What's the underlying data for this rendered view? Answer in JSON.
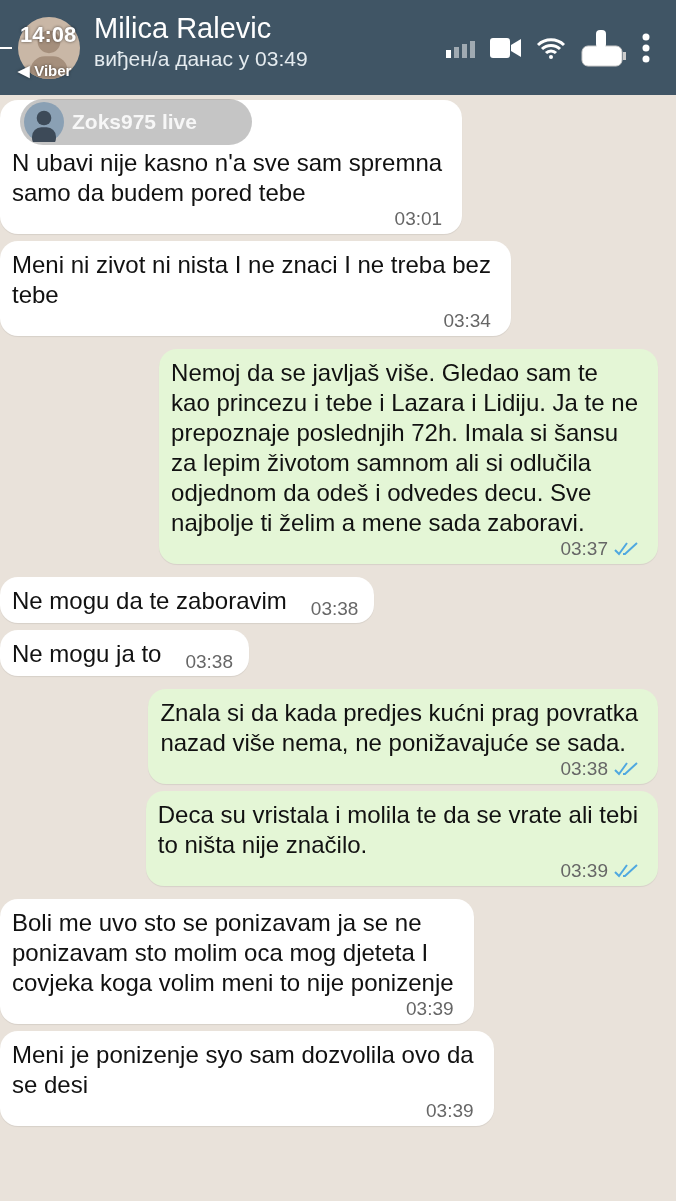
{
  "status_bar": {
    "time": "14:08",
    "back_app": "◀ Viber"
  },
  "header": {
    "name": "Milica Ralevic",
    "last_seen": "виђен/а данас у 03:49"
  },
  "live_overlay": {
    "label": "Zoks975 live"
  },
  "messages": [
    {
      "kind": "received",
      "text": "N     ubavi nije kasno n'a sve sam spremna\nsamo da budem pored tebe",
      "time": "03:01",
      "inline": false
    },
    {
      "kind": "received",
      "text": "Meni ni zivot ni nista I ne znaci I ne treba bez\ntebe",
      "time": "03:34",
      "inline": false
    },
    {
      "kind": "sent",
      "text": "Nemoj da se javljaš više. Gledao sam te\nkao princezu i tebe i Lazara i Lidiju. Ja te ne\nprepoznaje poslednjih 72h. Imala si šansu\nza lepim životom samnom ali si odlučila\nodjednom da odeš i odvedes decu. Sve\nnajbolje ti želim a mene sada zaboravi.",
      "time": "03:37",
      "read": true,
      "inline": false
    },
    {
      "kind": "received",
      "text": "Ne mogu da te zaboravim",
      "time": "03:38",
      "inline": true
    },
    {
      "kind": "received",
      "text": "Ne mogu ja to",
      "time": "03:38",
      "inline": true
    },
    {
      "kind": "sent",
      "text": "Znala si da kada predjes kućni prag povratka\nnazad više nema, ne ponižavajuće se sada.",
      "time": "03:38",
      "read": true,
      "inline": false
    },
    {
      "kind": "sent",
      "text": "Deca su vristala i molila te da se vrate ali tebi\nto ništa nije značilo.",
      "time": "03:39",
      "read": true,
      "inline": false
    },
    {
      "kind": "received",
      "text": "Boli me uvo sto se ponizavam ja se ne\nponizavam sto molim oca mog djeteta I\ncovjeka koga volim meni to nije ponizenje",
      "time": "03:39",
      "inline": false
    },
    {
      "kind": "received",
      "text": "Meni je ponizenje syo sam dozvolila ovo da\nse desi",
      "time": "03:39",
      "inline": false
    }
  ]
}
